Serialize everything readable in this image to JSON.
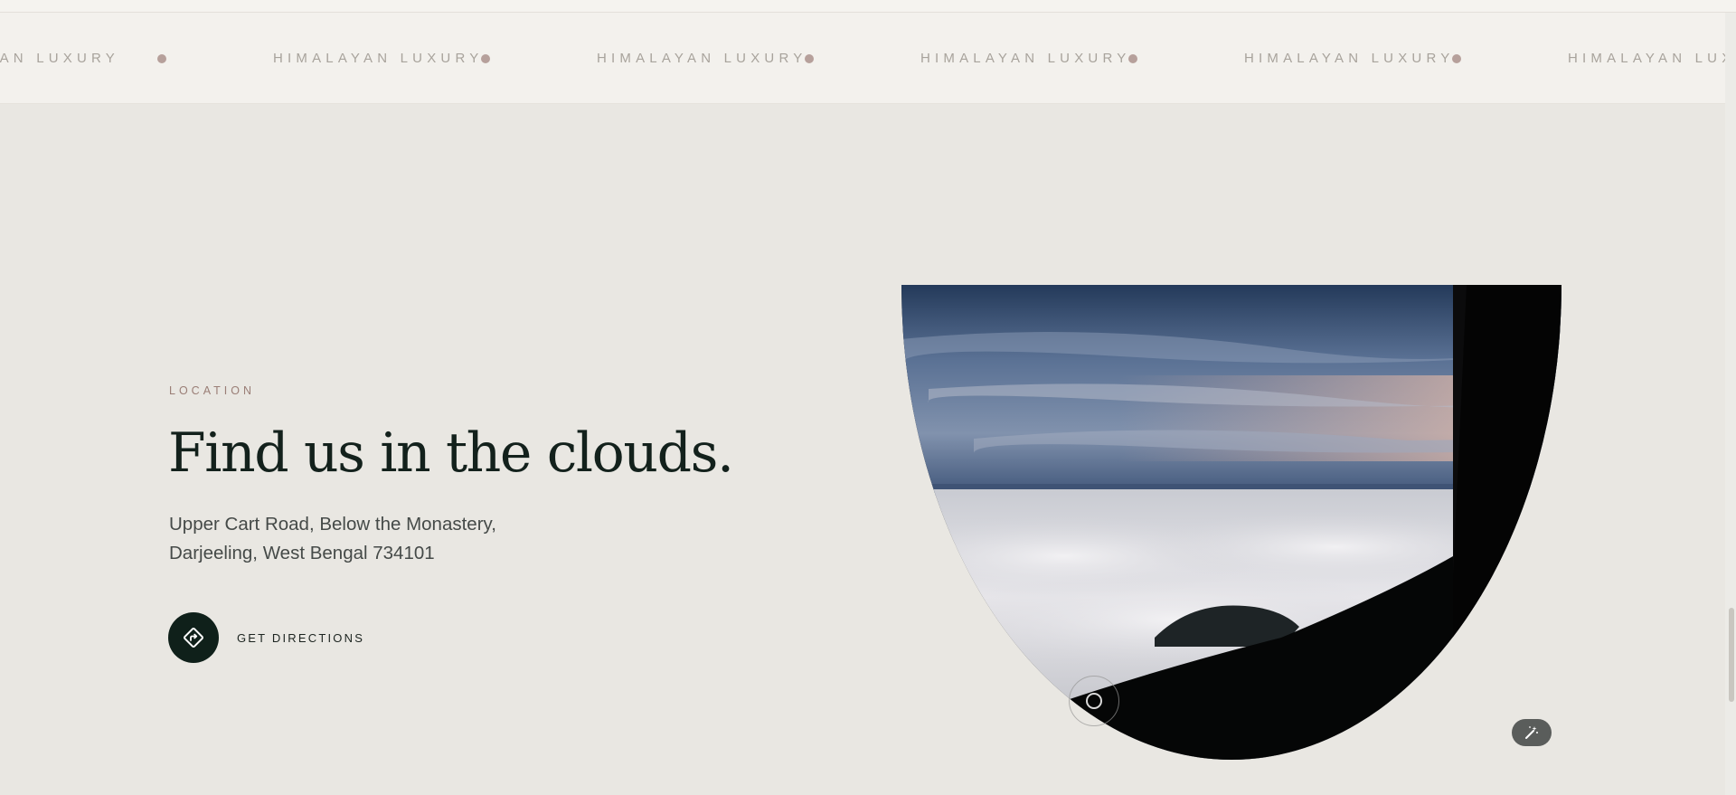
{
  "marquee": {
    "first_fragment": "YAN LUXURY",
    "items": [
      "HIMALAYAN LUXURY",
      "HIMALAYAN LUXURY",
      "HIMALAYAN LUXURY",
      "HIMALAYAN LUXURY",
      "HIMALAYAN LUXURY"
    ]
  },
  "location": {
    "eyebrow": "LOCATION",
    "title": "Find us in the clouds.",
    "address_line1": "Upper Cart Road, Below the Monastery,",
    "address_line2": "Darjeeling, West Bengal 734101",
    "directions_label": "GET DIRECTIONS",
    "directions_icon": "directions-sign-icon"
  },
  "media": {
    "image_description_icon": "sky-above-clouds-image",
    "play_icon": "circle-play-icon",
    "magic_icon": "magic-wand-icon"
  },
  "colors": {
    "background": "#e9e7e2",
    "marquee_bg": "#f3f1ed",
    "marquee_text": "#a8a39c",
    "marquee_dot": "#b6a09b",
    "eyebrow": "#9a7e76",
    "title": "#13211c",
    "button_dark": "#0f201a"
  }
}
